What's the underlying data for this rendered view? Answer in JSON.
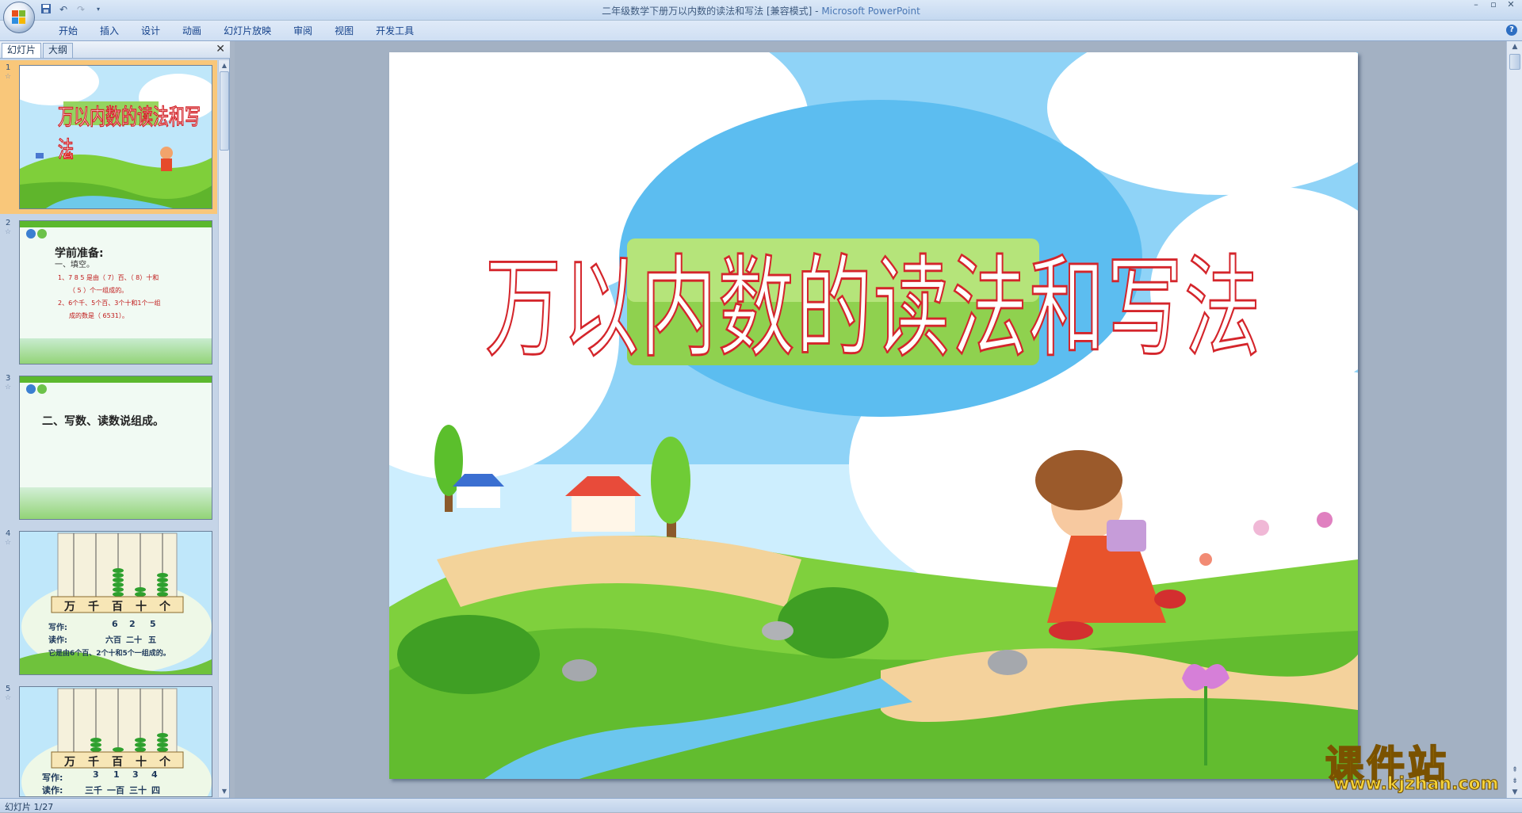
{
  "window": {
    "title": "二年级数学下册万以内数的读法和写法 [兼容模式]",
    "separator": " - ",
    "app_name": "Microsoft PowerPoint",
    "controls": [
      "–",
      "▫",
      "✕"
    ]
  },
  "quick_access": [
    "save-icon",
    "undo-icon",
    "redo-icon",
    "customize-icon"
  ],
  "ribbon": {
    "tabs": [
      "开始",
      "插入",
      "设计",
      "动画",
      "幻灯片放映",
      "审阅",
      "视图",
      "开发工具"
    ],
    "help": "?"
  },
  "left_panel": {
    "tabs": [
      "幻灯片",
      "大纲"
    ],
    "close": "✕",
    "slides": [
      {
        "num": "1",
        "title_text": "万以内数的读法和写法"
      },
      {
        "num": "2",
        "heading": "学前准备:",
        "sub": "一、填空。",
        "line1": "1、7 8 5 是由（ 7）百、（ 8）十和",
        "line1b": "（ 5 ）个一组成的。",
        "line2": "2、6个千、5个百、3个十和1个一组",
        "line2b": "成的数是（ 6531）。"
      },
      {
        "num": "3",
        "heading": "二、写数、读数说组成。"
      },
      {
        "num": "4",
        "places": [
          "万",
          "千",
          "百",
          "十",
          "个"
        ],
        "write_label": "写作:",
        "write_digits": [
          "6",
          "2",
          "5"
        ],
        "read_label": "读作:",
        "read_words": [
          "六百",
          "二十",
          "五"
        ],
        "composition": "它是由6个百、2个十和5个一组成的。"
      },
      {
        "num": "5",
        "places": [
          "万",
          "千",
          "百",
          "十",
          "个"
        ],
        "write_label": "写作:",
        "write_digits": [
          "3",
          "1",
          "3",
          "4"
        ],
        "read_label": "读作:",
        "read_words": [
          "三千",
          "一百",
          "三十",
          "四"
        ]
      }
    ]
  },
  "slide": {
    "title": "万以内数的读法和写法"
  },
  "status": {
    "text": "幻灯片 1/27"
  },
  "watermark": {
    "cn": "课件站",
    "url": "www.kjzhan.com"
  }
}
